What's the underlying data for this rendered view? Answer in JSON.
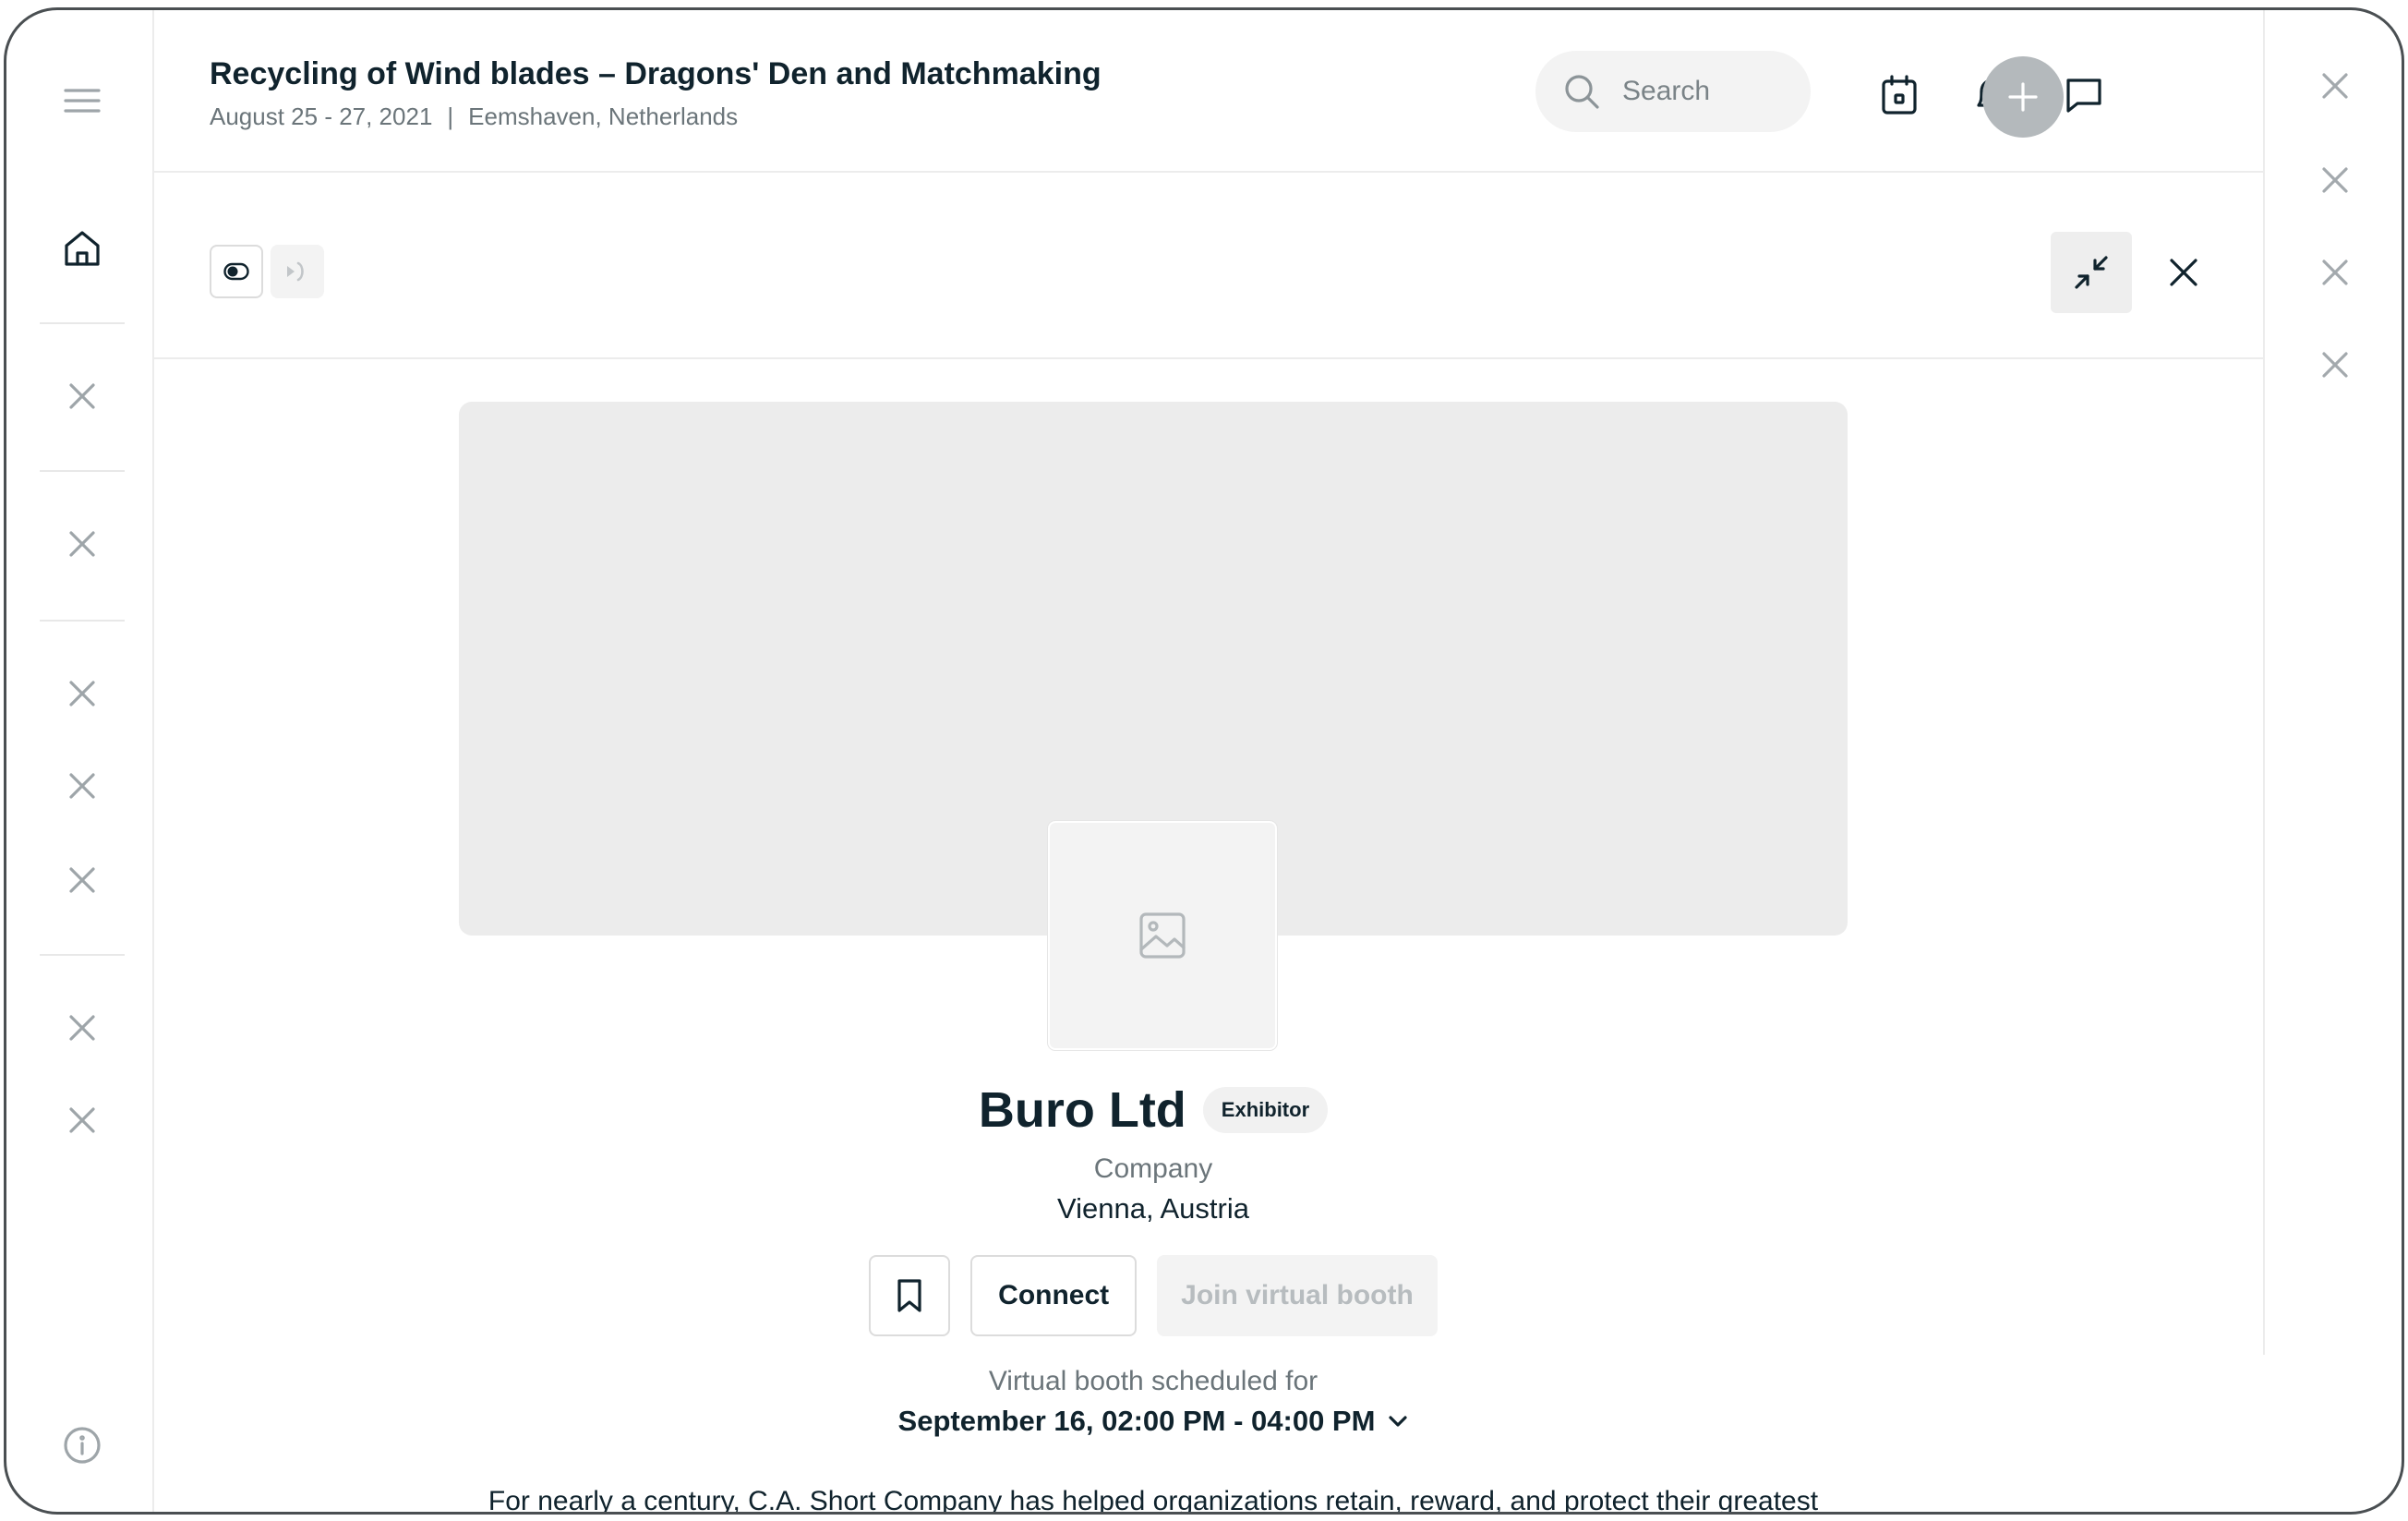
{
  "header": {
    "title": "Recycling of Wind blades – Dragons' Den and Matchmaking",
    "dates": "August 25 - 27, 2021",
    "separator": "|",
    "location": "Eemshaven, Netherlands",
    "search_placeholder": "Search"
  },
  "icons": {
    "menu": "menu-icon",
    "home": "home-icon",
    "close": "close-icon",
    "info": "info-icon",
    "calendar": "calendar-icon",
    "bell": "bell-icon",
    "chat": "chat-icon",
    "add": "plus-icon",
    "minimize": "minimize-icon",
    "bookmark": "bookmark-icon",
    "image_placeholder": "image-icon",
    "chevron": "chevron-down-icon"
  },
  "profile": {
    "name": "Buro Ltd",
    "badge": "Exhibitor",
    "type": "Company",
    "location": "Vienna, Austria",
    "connect_label": "Connect",
    "join_label": "Join virtual booth",
    "schedule_label": "Virtual booth scheduled for",
    "schedule_time": "September 16, 02:00 PM - 04:00 PM",
    "description": "For nearly a century, C.A. Short Company has helped organizations retain, reward, and protect their greatest"
  },
  "colors": {
    "text_primary": "#10232d",
    "text_secondary": "#6b757a",
    "muted_icon": "#9ea5a9",
    "add_button": "#b4b9bc",
    "placeholder_bg": "#ececec"
  }
}
